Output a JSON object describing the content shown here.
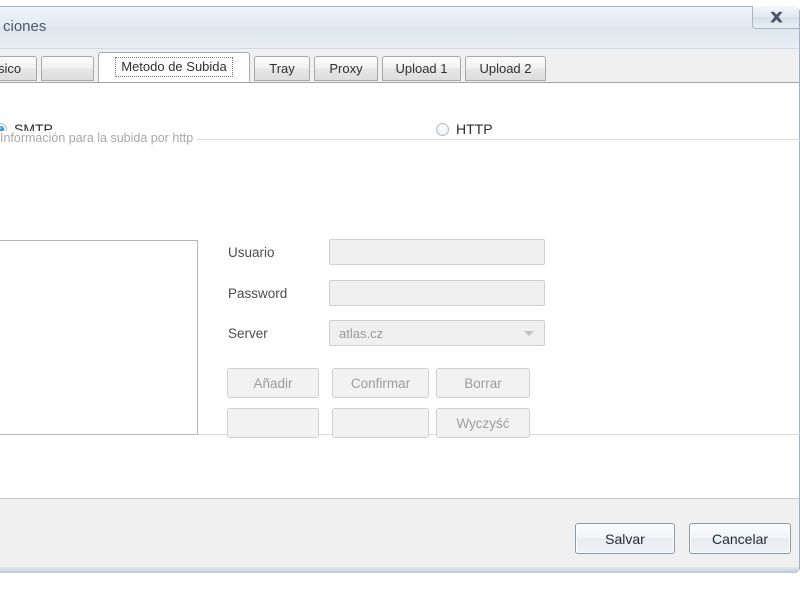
{
  "window": {
    "title": "ciones",
    "close_icon": "close-x-icon"
  },
  "tabs": [
    {
      "label": "ásico",
      "selected": false
    },
    {
      "label": "",
      "selected": false
    },
    {
      "label": "Metodo de Subida",
      "selected": true
    },
    {
      "label": "Tray",
      "selected": false
    },
    {
      "label": "Proxy",
      "selected": false
    },
    {
      "label": "Upload 1",
      "selected": false
    },
    {
      "label": "Upload 2",
      "selected": false
    }
  ],
  "page": {
    "method_radios": [
      {
        "label": "SMTP",
        "checked": true
      },
      {
        "label": "HTTP",
        "checked": false
      }
    ],
    "groupbox_title": "Información para la subida por http",
    "list_items": [],
    "fields": [
      {
        "label": "Usuario",
        "value": ""
      },
      {
        "label": "Password",
        "value": ""
      }
    ],
    "server_label": "Server",
    "server_value": "atlas.cz",
    "buttons_row1": [
      "Añadir",
      "Confirmar",
      "Borrar"
    ],
    "buttons_row2": [
      "",
      "",
      "Wyczyść"
    ]
  },
  "footer": {
    "save_label": "Salvar",
    "cancel_label": "Cancelar"
  },
  "colors": {
    "accent": "#2a8fd4",
    "titlebar": "#e4ebf3",
    "dialog_bg": "#f0f0f0",
    "page_bg": "#ffffff",
    "disabled_text": "#9d9d9d"
  }
}
